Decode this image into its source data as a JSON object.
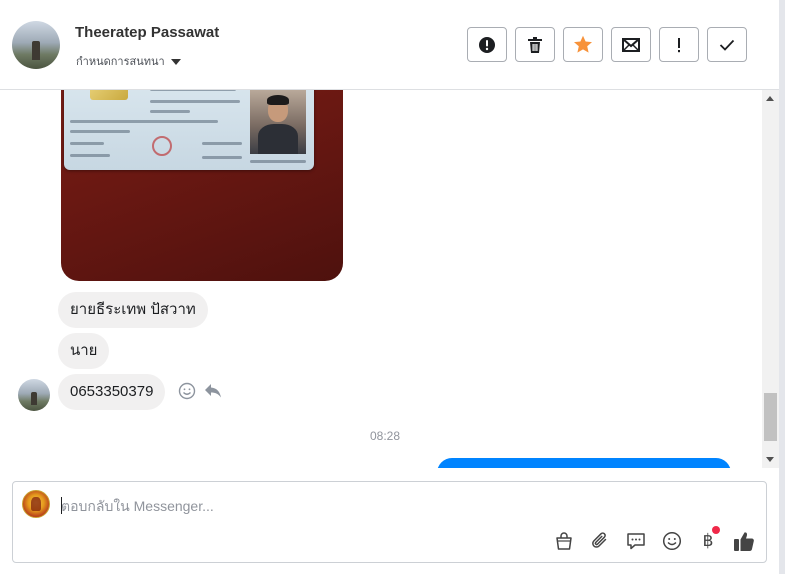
{
  "header": {
    "contact_name": "Theeratep Passawat",
    "subtitle": "กำหนดการสนทนา",
    "actions": [
      {
        "name": "spam-button",
        "icon": "exclamation-circle-icon"
      },
      {
        "name": "delete-button",
        "icon": "trash-icon"
      },
      {
        "name": "star-button",
        "icon": "star-icon",
        "color": "#f7923a"
      },
      {
        "name": "mark-unread-button",
        "icon": "envelope-icon"
      },
      {
        "name": "follow-up-button",
        "icon": "exclamation-icon"
      },
      {
        "name": "mark-done-button",
        "icon": "checkmark-icon"
      }
    ]
  },
  "messages": {
    "incoming": [
      {
        "text": "ยายธีระเทพ ปัสวาท"
      },
      {
        "text": "นาย"
      },
      {
        "text": "0653350379"
      }
    ],
    "timestamp": "08:28"
  },
  "composer": {
    "placeholder": "ตอบกลับใน Messenger...",
    "tools": [
      "shopping-bag-icon",
      "paperclip-icon",
      "saved-reply-icon",
      "emoji-icon",
      "baht-payment-icon",
      "thumbs-up-icon"
    ],
    "baht_symbol": "฿"
  },
  "colors": {
    "accent": "#0084ff",
    "incoming_bubble": "#f1f0f0",
    "star": "#f7923a",
    "notification": "#f02849"
  }
}
